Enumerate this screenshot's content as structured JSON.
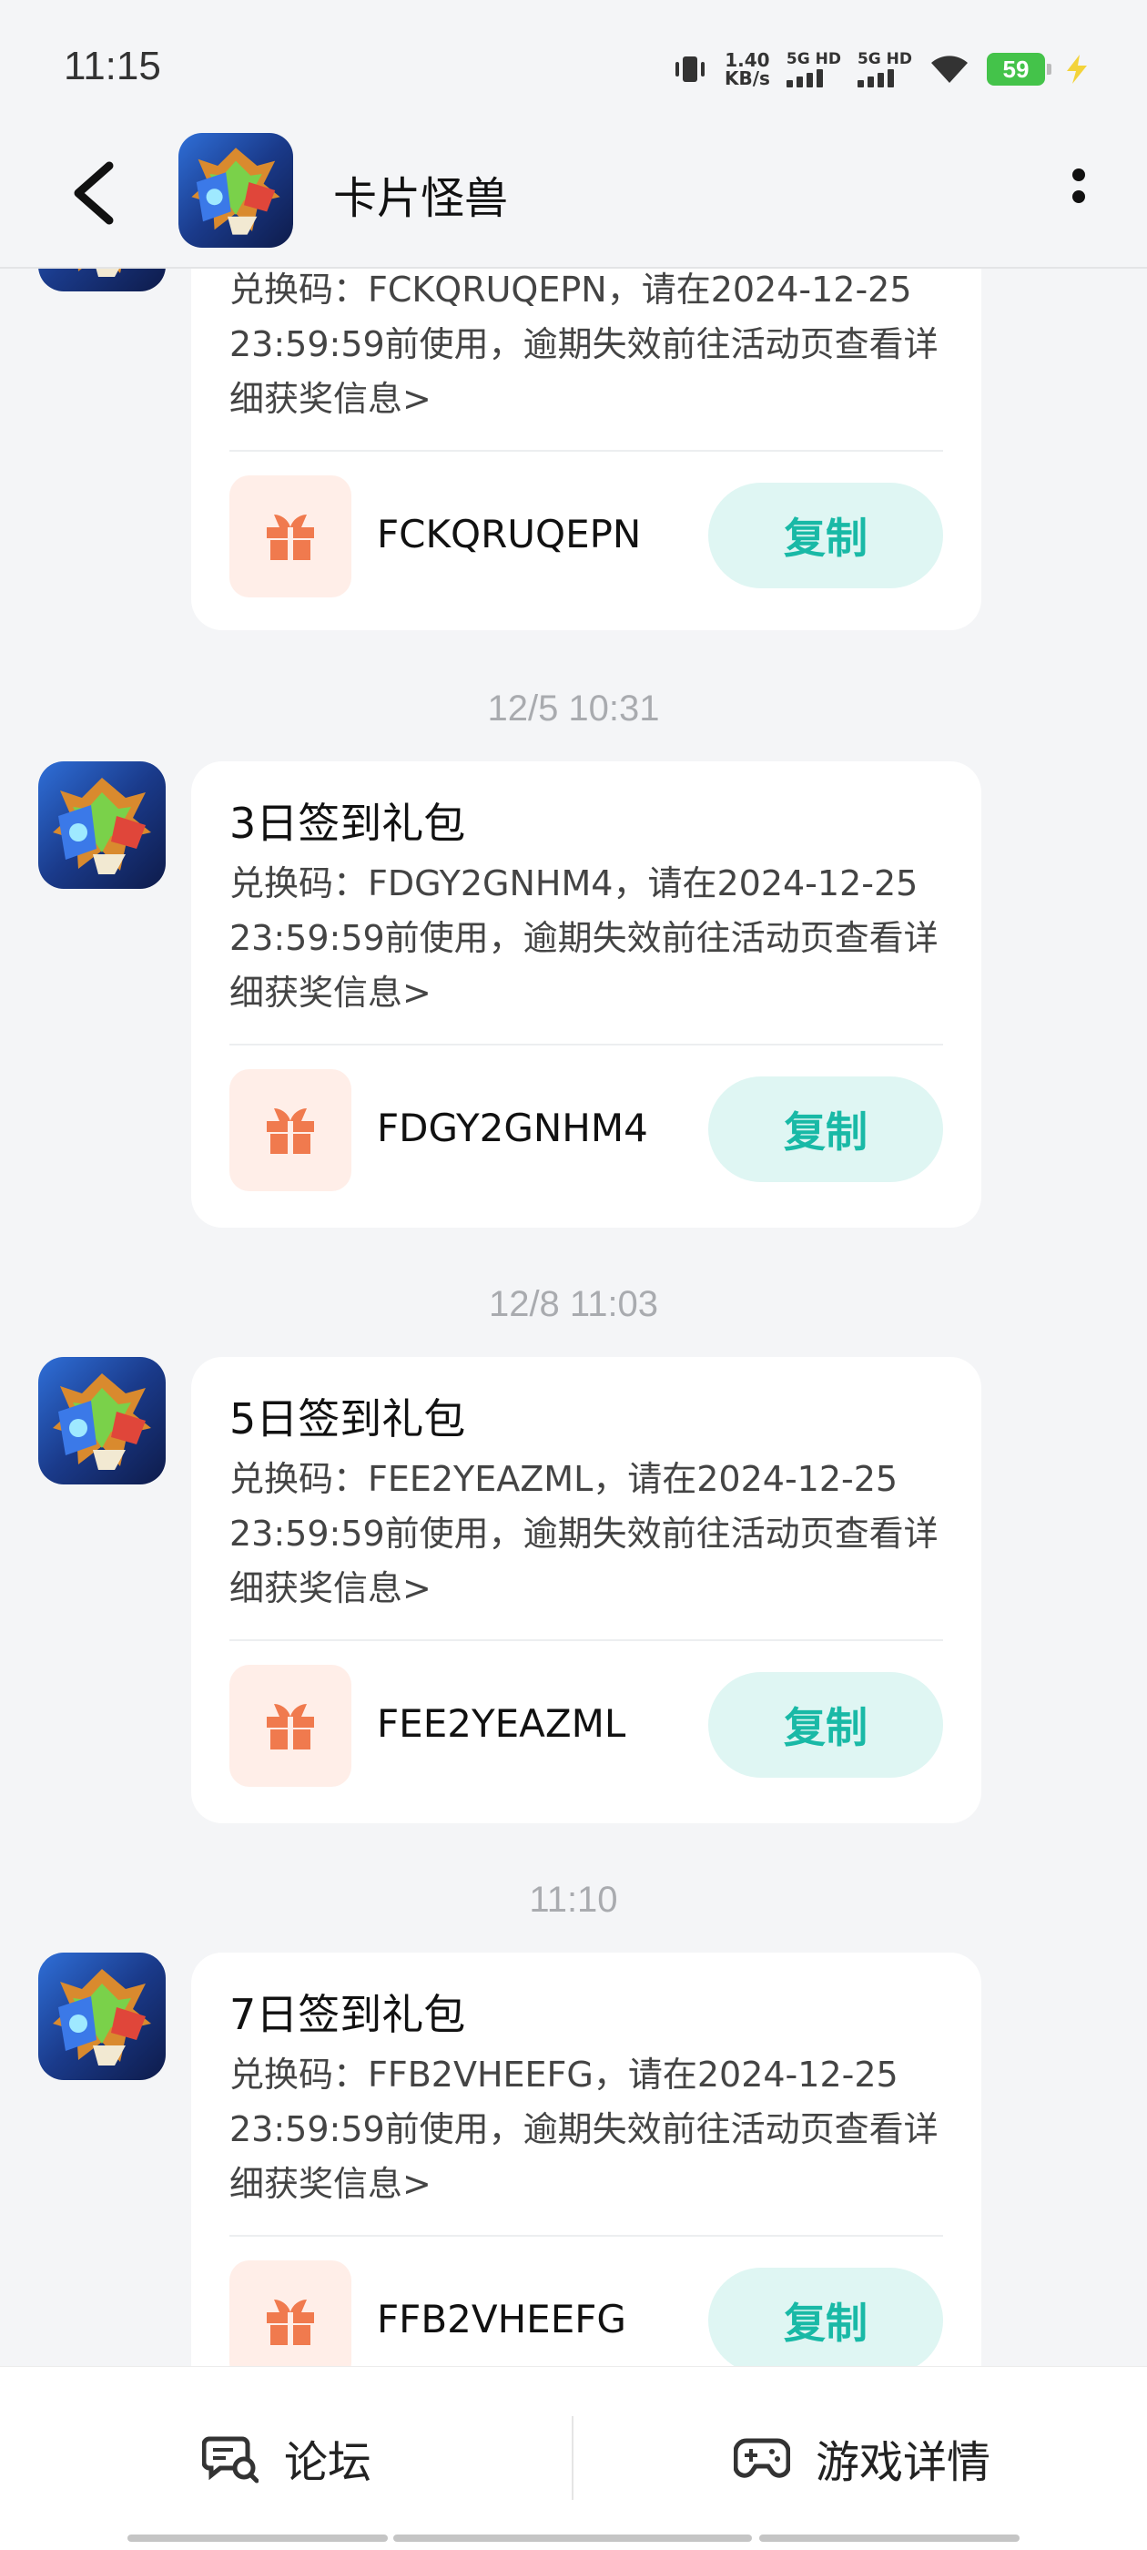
{
  "status_bar": {
    "time": "11:15",
    "speed_value": "1.40",
    "speed_unit": "KB/s",
    "sim1_label": "5G HD",
    "sim2_label": "5G HD",
    "battery": "59"
  },
  "header": {
    "title": "卡片怪兽",
    "back_icon": "back-arrow-icon",
    "more_icon": "more-vertical-icon"
  },
  "messages": [
    {
      "title": "",
      "body": "兑换码：FCKQRUQEPN，请在2024-12-25 23:59:59前使用，逾期失效前往活动页查看详细获奖信息>",
      "code": "FCKQRUQEPN",
      "copy_label": "复制"
    },
    {
      "timestamp": "12/5  10:31",
      "title": "3日签到礼包",
      "body": "兑换码：FDGY2GNHM4，请在2024-12-25 23:59:59前使用，逾期失效前往活动页查看详细获奖信息>",
      "code": "FDGY2GNHM4",
      "copy_label": "复制"
    },
    {
      "timestamp": "12/8  11:03",
      "title": "5日签到礼包",
      "body": "兑换码：FEE2YEAZML，请在2024-12-25 23:59:59前使用，逾期失效前往活动页查看详细获奖信息>",
      "code": "FEE2YEAZML",
      "copy_label": "复制"
    },
    {
      "timestamp": "11:10",
      "title": "7日签到礼包",
      "body": "兑换码：FFB2VHEEFG，请在2024-12-25 23:59:59前使用，逾期失效前往活动页查看详细获奖信息>",
      "code": "FFB2VHEEFG",
      "copy_label": "复制"
    }
  ],
  "bottom_bar": {
    "forum_label": "论坛",
    "game_detail_label": "游戏详情"
  },
  "colors": {
    "accent": "#19b9a6",
    "copy_bg": "#dff6f3",
    "gift": "#f07a4e",
    "gift_bg": "#ffeee8"
  }
}
